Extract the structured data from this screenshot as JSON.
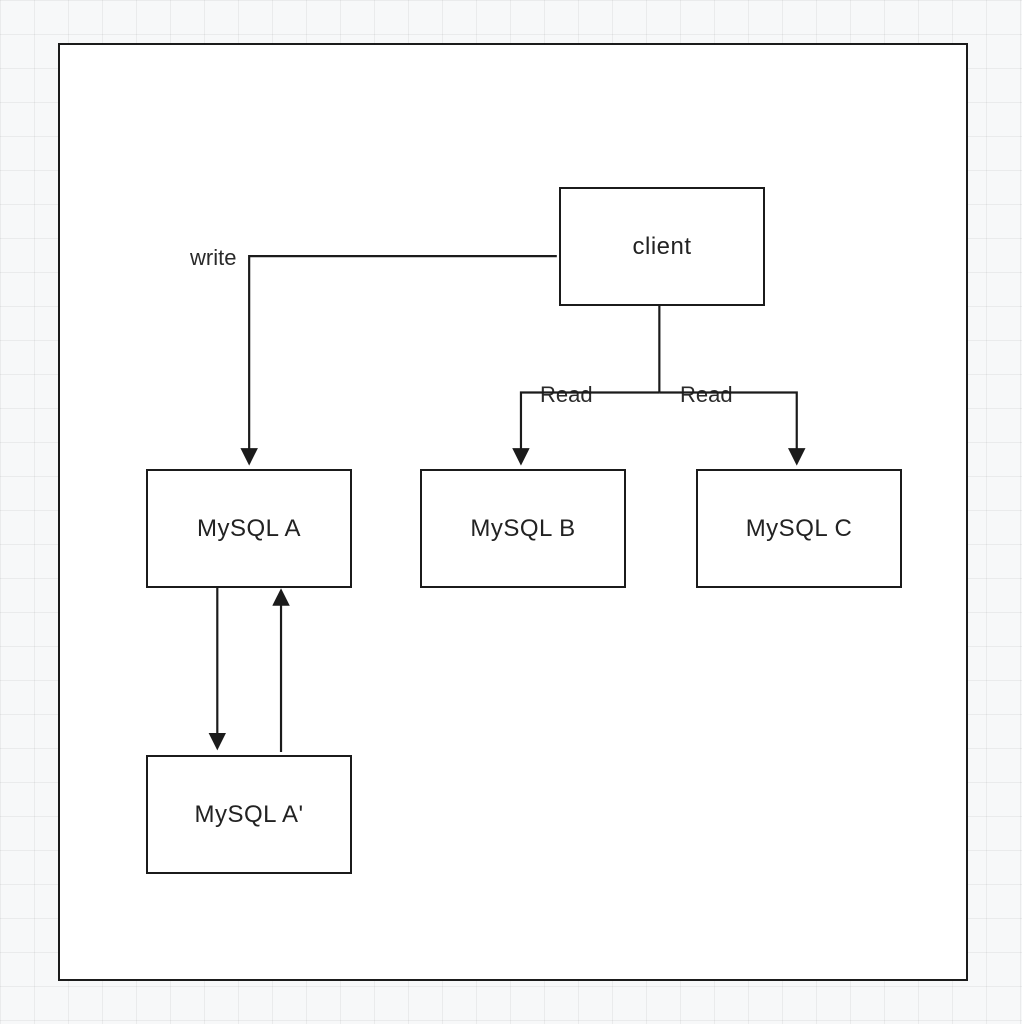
{
  "nodes": {
    "client": {
      "label": "client"
    },
    "mysql_a": {
      "label": "MySQL A"
    },
    "mysql_b": {
      "label": "MySQL B"
    },
    "mysql_c": {
      "label": "MySQL C"
    },
    "mysql_ap": {
      "label": "MySQL A'"
    }
  },
  "edge_labels": {
    "write": "write",
    "read_b": "Read",
    "read_c": "Read"
  }
}
